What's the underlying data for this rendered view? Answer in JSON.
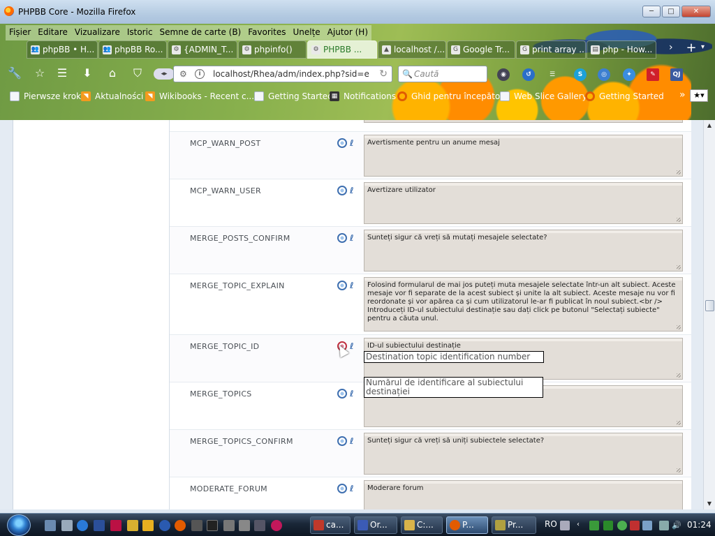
{
  "window": {
    "title": "PHPBB Core - Mozilla Firefox",
    "controls": [
      "─",
      "□",
      "✕"
    ]
  },
  "menu": [
    "Fișier",
    "Editare",
    "Vizualizare",
    "Istoric",
    "Semne de carte (B)",
    "Favorites",
    "Unelțe",
    "Ajutor (H)"
  ],
  "tabs": [
    {
      "label": "phpBB • H...",
      "icon": "users-icon",
      "icon_glyph": "👥"
    },
    {
      "label": "phpBB Ro...",
      "icon": "users-icon",
      "icon_glyph": "👥"
    },
    {
      "label": "{ADMIN_T...",
      "icon": "settings-icon",
      "icon_glyph": "⚙"
    },
    {
      "label": "phpinfo()",
      "icon": "settings-icon",
      "icon_glyph": "⚙"
    },
    {
      "label": "PHPBB ...",
      "icon": "settings-icon",
      "icon_glyph": "⚙",
      "active": true
    },
    {
      "label": "localhost /...",
      "icon": "pma-icon",
      "icon_glyph": "▲"
    },
    {
      "label": "Google Tr...",
      "icon": "translate-icon",
      "icon_glyph": "G"
    },
    {
      "label": "print array ...",
      "icon": "google-icon",
      "icon_glyph": "G"
    },
    {
      "label": "php - How...",
      "icon": "stackoverflow-icon",
      "icon_glyph": "▤"
    }
  ],
  "navigation": {
    "url": "localhost/Rhea/adm/index.php?sid=e",
    "search_placeholder": "Caută"
  },
  "bookmarks": [
    {
      "label": "Pierwsze kroki",
      "icon": "page"
    },
    {
      "label": "Aktualności",
      "icon": "rss"
    },
    {
      "label": "Wikibooks - Recent c...",
      "icon": "rss"
    },
    {
      "label": "Getting Started",
      "icon": "page"
    },
    {
      "label": "Notifications",
      "icon": "dark"
    },
    {
      "label": "Ghid pentru începători",
      "icon": "ff"
    },
    {
      "label": "Web Slice Gallery",
      "icon": "page"
    },
    {
      "label": "Getting Started",
      "icon": "ff"
    }
  ],
  "rows": [
    {
      "key": "MCP_WARN_POST",
      "value": "Avertismente pentru un anume mesaj"
    },
    {
      "key": "MCP_WARN_USER",
      "value": "Avertizare utilizator"
    },
    {
      "key": "MERGE_POSTS_CONFIRM",
      "value": "Sunteți sigur că vreți să mutați mesajele selectate?"
    },
    {
      "key": "MERGE_TOPIC_EXPLAIN",
      "value": "Folosind formularul de mai jos puteți muta mesajele selectate într-un alt subiect. Aceste mesaje vor fi separate de la acest subiect și unite la alt subiect. Aceste mesaje nu vor fi reordonate și vor apărea ca și cum utilizatorul le-ar fi publicat în noul subiect.<br /> Introduceți ID-ul subiectului destinație sau dați click pe butonul \"Selectați subiecte\" pentru a căuta unul."
    },
    {
      "key": "MERGE_TOPIC_ID",
      "value": "ID-ul subiectului destinație",
      "active": true
    },
    {
      "key": "MERGE_TOPICS",
      "value": ""
    },
    {
      "key": "MERGE_TOPICS_CONFIRM",
      "value": "Sunteți sigur că vreți să uniți subiectele selectate?"
    },
    {
      "key": "MODERATE_FORUM",
      "value": "Moderare forum"
    }
  ],
  "tooltips": {
    "english": "Destination topic identification number",
    "romanian": "Numărul de identificare al subiectului destinației"
  },
  "taskbar": {
    "tasks": [
      {
        "label": "ca...",
        "color": "#c0392b"
      },
      {
        "label": "Or...",
        "color": "#3b5bb5"
      },
      {
        "label": "C:...",
        "color": "#d9b34a"
      },
      {
        "label": "P...",
        "color": "#e25b00",
        "active": true
      },
      {
        "label": "Pr...",
        "color": "#b0a040"
      }
    ],
    "language": "RO",
    "time": "01:24"
  }
}
